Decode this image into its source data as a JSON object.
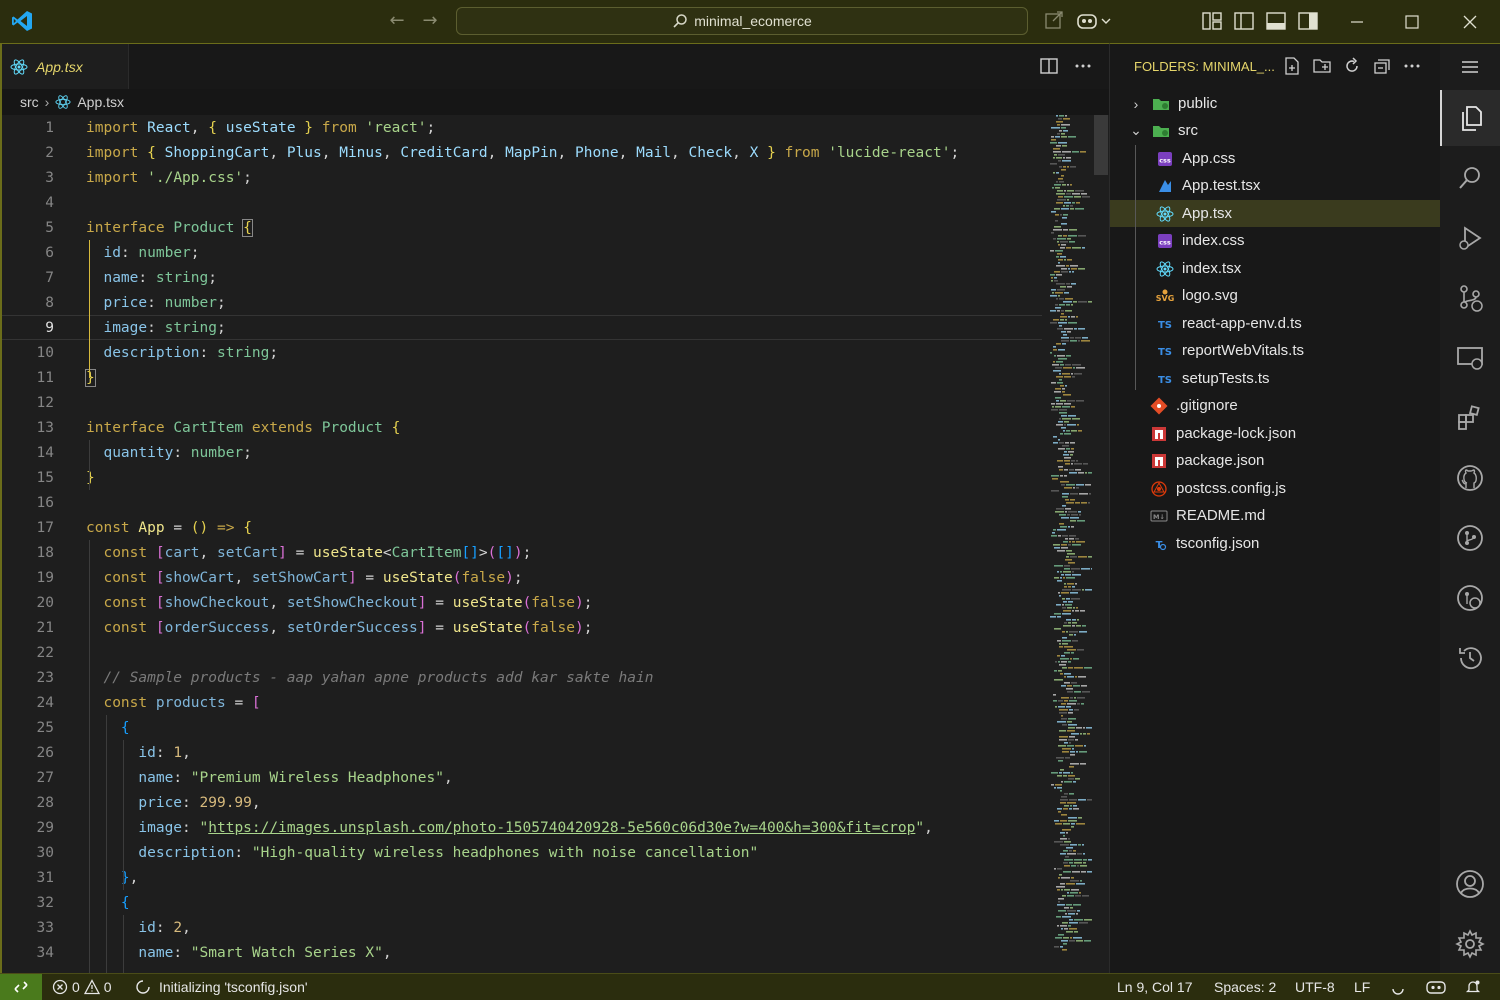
{
  "window": {
    "search_label": "minimal_ecomerce"
  },
  "editor": {
    "tab_label": "App.tsx",
    "breadcrumb": {
      "folder": "src",
      "file": "App.tsx"
    },
    "active_line": 9,
    "lines": [
      "1",
      "2",
      "3",
      "4",
      "5",
      "6",
      "7",
      "8",
      "9",
      "10",
      "11",
      "12",
      "13",
      "14",
      "15",
      "16",
      "17",
      "18",
      "19",
      "20",
      "21",
      "22",
      "23",
      "24",
      "25",
      "26",
      "27",
      "28",
      "29",
      "30",
      "31",
      "32",
      "33",
      "34"
    ],
    "code": {
      "l23_comment": "// Sample products - aap yahan apne products add kar sakte hain",
      "l27_name": "\"Premium Wireless Headphones\"",
      "l28_price": "299.99",
      "l29_image": "https://images.unsplash.com/photo-1505740420928-5e560c06d30e?w=400&h=300&fit=crop",
      "l30_desc": "\"High-quality wireless headphones with noise cancellation\"",
      "l34_name": "\"Smart Watch Series X\""
    }
  },
  "explorer": {
    "header": "FOLDERS: MINIMAL_...",
    "items": [
      {
        "label": "public",
        "kind": "folder",
        "expanded": false
      },
      {
        "label": "src",
        "kind": "folder",
        "expanded": true
      },
      {
        "label": "App.css",
        "kind": "css"
      },
      {
        "label": "App.test.tsx",
        "kind": "test"
      },
      {
        "label": "App.tsx",
        "kind": "react",
        "selected": true
      },
      {
        "label": "index.css",
        "kind": "css"
      },
      {
        "label": "index.tsx",
        "kind": "react"
      },
      {
        "label": "logo.svg",
        "kind": "svg"
      },
      {
        "label": "react-app-env.d.ts",
        "kind": "ts"
      },
      {
        "label": "reportWebVitals.ts",
        "kind": "ts"
      },
      {
        "label": "setupTests.ts",
        "kind": "ts"
      },
      {
        "label": ".gitignore",
        "kind": "git"
      },
      {
        "label": "package-lock.json",
        "kind": "npm"
      },
      {
        "label": "package.json",
        "kind": "npm"
      },
      {
        "label": "postcss.config.js",
        "kind": "postcss"
      },
      {
        "label": "README.md",
        "kind": "md"
      },
      {
        "label": "tsconfig.json",
        "kind": "tsconfig"
      }
    ]
  },
  "status": {
    "errors": "0",
    "warnings": "0",
    "message": "Initializing 'tsconfig.json'",
    "position": "Ln 9, Col 17",
    "spaces": "Spaces: 2",
    "encoding": "UTF-8",
    "eol": "LF"
  },
  "colors": {
    "accent": "#e6d66b",
    "titlebar": "#2b2d0e",
    "remote": "#4a7a1c"
  }
}
